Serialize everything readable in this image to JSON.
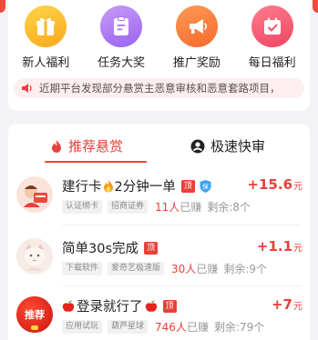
{
  "quick_entries": [
    {
      "label": "新人福利",
      "icon": "gift-icon",
      "color": "#fdbd2c"
    },
    {
      "label": "任务大奖",
      "icon": "task-list-icon",
      "color": "#b07cf3"
    },
    {
      "label": "推广奖励",
      "icon": "megaphone-icon",
      "color": "#fb7a3d"
    },
    {
      "label": "每日福利",
      "icon": "calendar-check-icon",
      "color": "#f4546a"
    }
  ],
  "notice": {
    "icon": "speaker-icon",
    "text": "近期平台发现部分悬赏主恶意审核和恶意套路项目，"
  },
  "tabs": {
    "recommended": "推荐悬赏",
    "fast_review": "极速快审"
  },
  "tasks": [
    {
      "title_pre": "建行卡",
      "title_post": "2分钟一单",
      "badge": "顶",
      "tags": [
        "认证绑卡",
        "招商证券"
      ],
      "earned_count": "11人",
      "earned_suffix": "已赚",
      "remaining": "剩余:8个",
      "reward": "+15.6",
      "unit": "元"
    },
    {
      "title_pre": "简单30s完成",
      "title_post": "",
      "badge": "顶",
      "tags": [
        "下载软件",
        "爱奇艺极速版"
      ],
      "earned_count": "30人",
      "earned_suffix": "已赚",
      "remaining": "剩余:9个",
      "reward": "+1.1",
      "unit": "元"
    },
    {
      "title_pre": "登录就行了",
      "title_post": "",
      "badge": "顶",
      "avatar_text": "推荐",
      "tags": [
        "应用试玩",
        "葫芦星球"
      ],
      "earned_count": "746人",
      "earned_suffix": "已赚",
      "remaining": "剩余:79个",
      "reward": "+7",
      "unit": "元"
    }
  ],
  "colors": {
    "accent": "#e8403a",
    "background": "#f3f3f5"
  }
}
